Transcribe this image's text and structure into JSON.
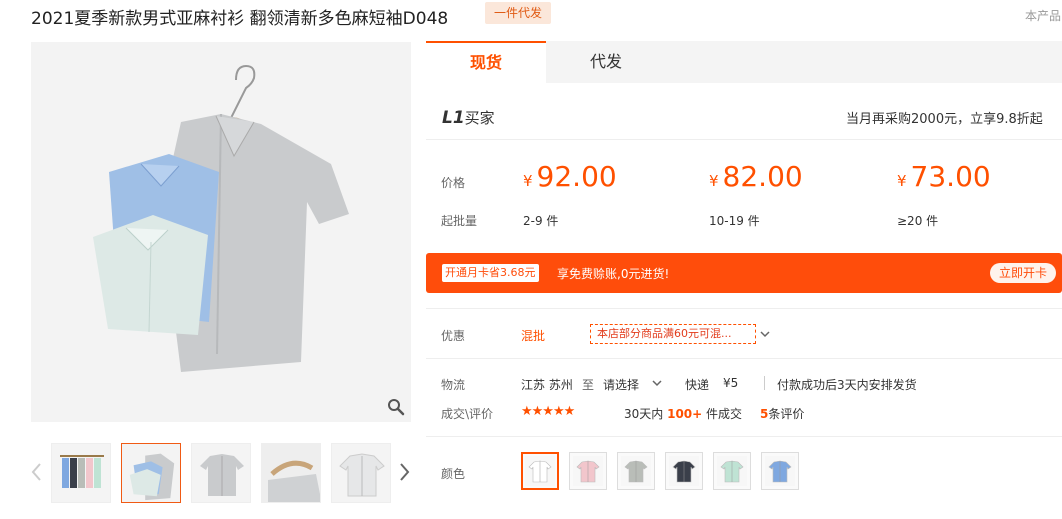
{
  "product": {
    "title": "2021夏季新款男式亚麻衬衫 翻领清新多色麻短袖D048",
    "tag": "一件代发",
    "right_tip": "本产品"
  },
  "gallery": {
    "main_alt": "shirt-main-photo",
    "thumbs": [
      "thumb-rack",
      "thumb-stack",
      "thumb-grey-front",
      "thumb-hanger",
      "thumb-white-front"
    ],
    "active_thumb": 1
  },
  "tabs": [
    {
      "label": "现货",
      "active": true
    },
    {
      "label": "代发",
      "active": false
    }
  ],
  "buyer": {
    "level": "L1",
    "label": "买家",
    "tip": "当月再采购2000元，立享9.8折起"
  },
  "pricing": {
    "price_label": "价格",
    "qty_label": "起批量",
    "currency": "¥",
    "tiers": [
      {
        "price": "92.00",
        "qty": "2-9 件"
      },
      {
        "price": "82.00",
        "qty": "10-19 件"
      },
      {
        "price": "73.00",
        "qty": "≥20 件"
      }
    ]
  },
  "banner": {
    "badge": "开通月卡省3.68元",
    "text": "享免费赊账,0元进货!",
    "button": "立即开卡"
  },
  "promo": {
    "label": "优惠",
    "link": "混批",
    "coupon": "本店部分商品满60元可混..."
  },
  "shipping": {
    "label": "物流",
    "from": "江苏 苏州",
    "to_word": "至",
    "dest": "请选择",
    "method": "快递",
    "fee": "¥5",
    "note": "付款成功后3天内安排发货"
  },
  "trade": {
    "label": "成交\\评价",
    "rating": 4.5,
    "stars": "★★★★★",
    "days": "30天内",
    "count": "100+",
    "count_suffix": "件成交",
    "reviews_count": "5",
    "reviews_suffix": "条评价"
  },
  "colors": {
    "label": "颜色",
    "swatches": [
      "#ffffff",
      "#f2c6cc",
      "#b9bdb8",
      "#3a3f4a",
      "#bfe3d4",
      "#7fa8e0"
    ],
    "active": 0
  },
  "theme": {
    "accent": "#ff5000",
    "banner": "#ff4d0b"
  }
}
